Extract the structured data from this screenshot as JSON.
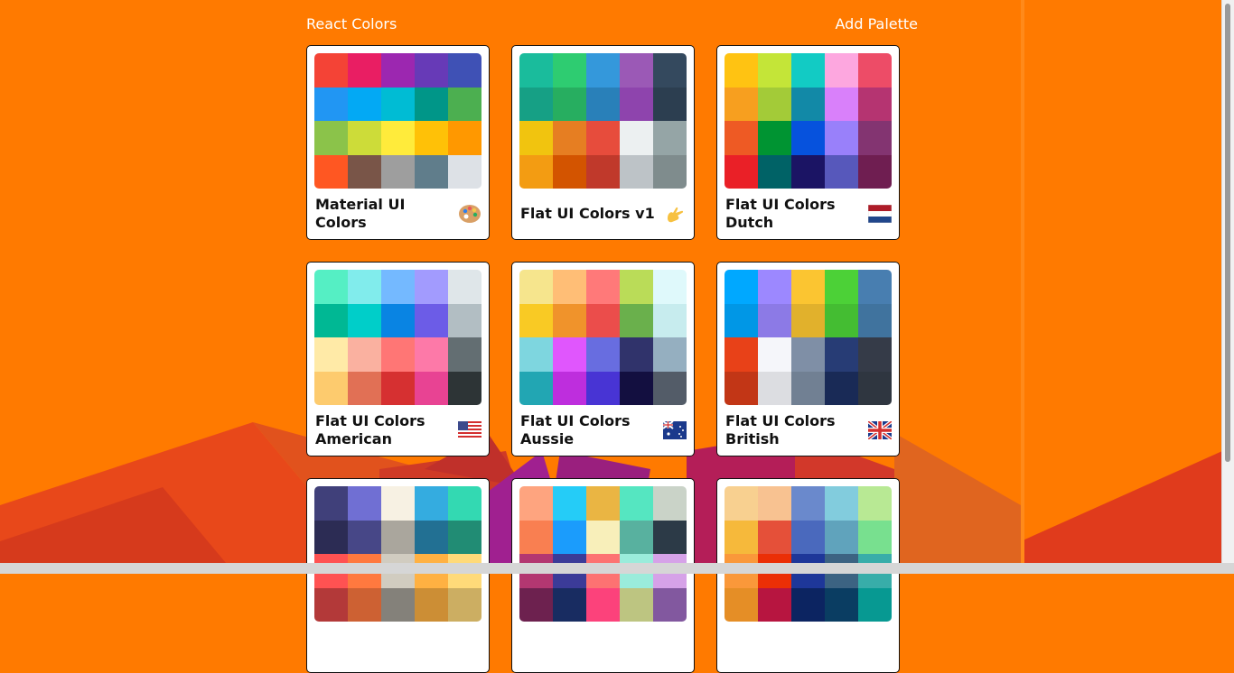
{
  "nav": {
    "brand": "React Colors",
    "add_palette": "Add Palette"
  },
  "palettes": [
    {
      "name": "Material UI Colors",
      "emoji": "palette-icon",
      "colors": [
        "#F44336",
        "#E91E63",
        "#9C27B0",
        "#673AB7",
        "#3F51B5",
        "#2196F3",
        "#03A9F4",
        "#00BCD4",
        "#009688",
        "#4CAF50",
        "#8BC34A",
        "#CDDC39",
        "#FFEB3B",
        "#FFC107",
        "#FF9800",
        "#FF5722",
        "#795548",
        "#9E9E9E",
        "#607D8B",
        "#DDE1E6"
      ]
    },
    {
      "name": "Flat UI Colors v1",
      "emoji": "call-me-hand-icon",
      "colors": [
        "#1ABC9C",
        "#2ECC71",
        "#3498DB",
        "#9B59B6",
        "#34495E",
        "#16A085",
        "#27AE60",
        "#2980B9",
        "#8E44AD",
        "#2C3E50",
        "#F1C40F",
        "#E67E22",
        "#E74C3C",
        "#ECF0F1",
        "#95A5A6",
        "#F39C12",
        "#D35400",
        "#C0392B",
        "#BDC3C7",
        "#7F8C8D"
      ]
    },
    {
      "name": "Flat UI Colors Dutch",
      "emoji": "netherlands-flag-icon",
      "colors": [
        "#FFC312",
        "#C4E538",
        "#12CBC4",
        "#FDA7DF",
        "#ED4C67",
        "#F79F1F",
        "#A3CB38",
        "#1289A7",
        "#D980FA",
        "#B53471",
        "#EE5A24",
        "#009432",
        "#0652DD",
        "#9980FA",
        "#833471",
        "#EA2027",
        "#006266",
        "#1B1464",
        "#5758BB",
        "#6F1E51"
      ]
    },
    {
      "name": "Flat UI Colors American",
      "emoji": "us-flag-icon",
      "colors": [
        "#55EFC4",
        "#81ECEC",
        "#74B9FF",
        "#A29BFE",
        "#DFE6E9",
        "#00B894",
        "#00CEC9",
        "#0984E3",
        "#6C5CE7",
        "#B2BEC3",
        "#FFEAA7",
        "#FAB1A0",
        "#FF7675",
        "#FD79A8",
        "#636E72",
        "#FDCB6E",
        "#E17055",
        "#D63031",
        "#E84393",
        "#2D3436"
      ]
    },
    {
      "name": "Flat UI Colors Aussie",
      "emoji": "australia-flag-icon",
      "colors": [
        "#F6E58D",
        "#FFBE76",
        "#FF7979",
        "#BADC58",
        "#DFF9FB",
        "#F9CA24",
        "#F0932B",
        "#EB4D4B",
        "#6AB04C",
        "#C7ECEE",
        "#7ED6DF",
        "#E056FD",
        "#686DE0",
        "#30336B",
        "#95AFC0",
        "#22A6B3",
        "#BE2EDD",
        "#4834D4",
        "#130F40",
        "#535C68"
      ]
    },
    {
      "name": "Flat UI Colors British",
      "emoji": "uk-flag-icon",
      "colors": [
        "#00A8FF",
        "#9C88FF",
        "#FBC531",
        "#4CD137",
        "#487EB0",
        "#0097E6",
        "#8C7AE6",
        "#E1B12C",
        "#44BD32",
        "#40739E",
        "#E84118",
        "#F5F6FA",
        "#7F8FA6",
        "#273C75",
        "#353B48",
        "#C23616",
        "#DCDDE1",
        "#718093",
        "#192A56",
        "#2F3640"
      ]
    },
    {
      "name": "",
      "emoji": "",
      "colors": [
        "#40407A",
        "#706FD3",
        "#F7F1E3",
        "#34ACE0",
        "#33D9B2",
        "#2C2C54",
        "#474787",
        "#AAA69D",
        "#227093",
        "#218C74",
        "#FF5252",
        "#FF793F",
        "#D1CCC0",
        "#FFB142",
        "#FFDA79",
        "#B33939",
        "#CD6133",
        "#84817A",
        "#CC8E35",
        "#CCAE62"
      ]
    },
    {
      "name": "",
      "emoji": "",
      "colors": [
        "#FEA47F",
        "#25CCF7",
        "#EAB543",
        "#55E6C1",
        "#CAD3C8",
        "#F97F51",
        "#1B9CFC",
        "#F8EFBA",
        "#58B19F",
        "#2C3A47",
        "#B33771",
        "#3B3B98",
        "#FD7272",
        "#9AECDB",
        "#D6A2E8",
        "#6D214F",
        "#182C61",
        "#FC427B",
        "#BDC581",
        "#82589F"
      ]
    },
    {
      "name": "",
      "emoji": "",
      "colors": [
        "#F8D090",
        "#F8C291",
        "#6A89CC",
        "#82CCDD",
        "#B8E994",
        "#F6B93B",
        "#E55039",
        "#4A69BD",
        "#60A3BC",
        "#78E08F",
        "#FA983A",
        "#EB2F06",
        "#1E3799",
        "#3C6382",
        "#38ADA9",
        "#E58E26",
        "#B71540",
        "#0C2461",
        "#0A3D62",
        "#079992"
      ]
    }
  ]
}
